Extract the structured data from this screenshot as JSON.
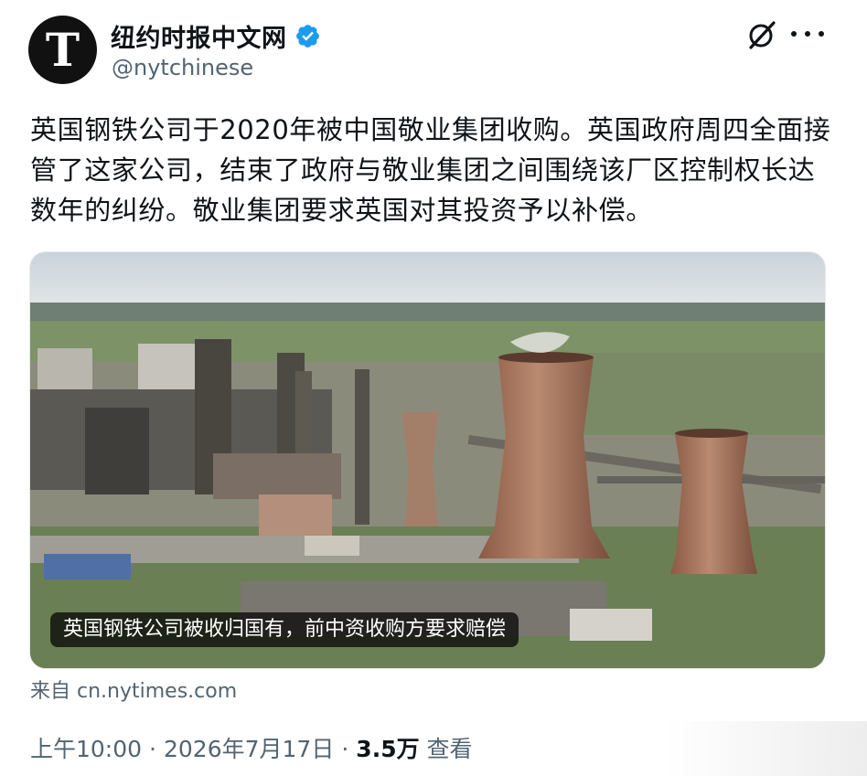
{
  "profile": {
    "avatar_letter": "T",
    "display_name": "纽约时报中文网",
    "handle": "@nytchinese",
    "verified": true
  },
  "tweet": {
    "text": "英国钢铁公司于2020年被中国敬业集团收购。英国政府周四全面接管了这家公司，结束了政府与敬业集团之间围绕该厂区控制权长达数年的纠纷。敬业集团要求英国对其投资予以补偿。",
    "media_caption": "英国钢铁公司被收归国有，前中资收购方要求赔偿",
    "source": "来自 cn.nytimes.com"
  },
  "meta": {
    "time": "上午10:00",
    "date": "2026年7月17日",
    "views_count": "3.5万",
    "views_label": "查看"
  },
  "icons": {
    "grok": "grok-icon",
    "more": "more-icon",
    "verified": "verified-badge-icon"
  },
  "colors": {
    "verified_blue": "#1d9bf0",
    "secondary_text": "#536471"
  }
}
